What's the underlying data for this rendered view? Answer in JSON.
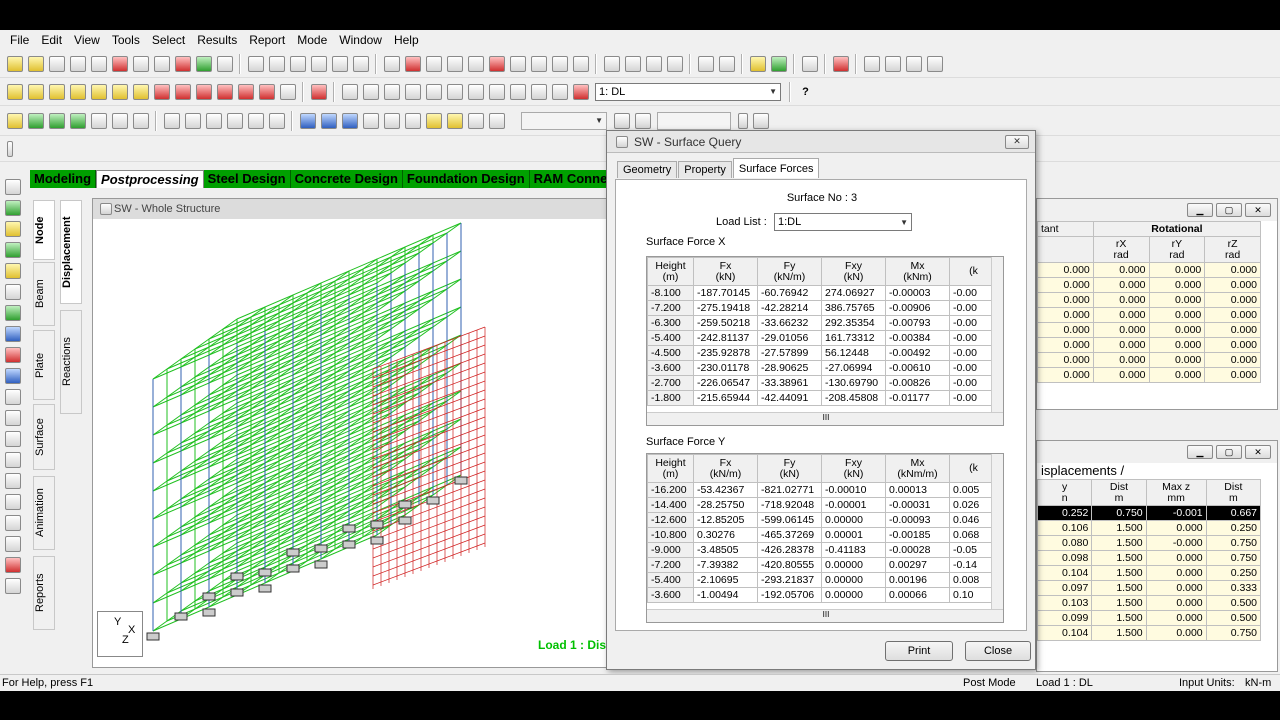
{
  "menu": [
    "File",
    "Edit",
    "View",
    "Tools",
    "Select",
    "Results",
    "Report",
    "Mode",
    "Window",
    "Help"
  ],
  "toolbar": {
    "load_combo": "1: DL"
  },
  "page_tabs": [
    "Modeling",
    "Postprocessing",
    "Steel Design",
    "Concrete Design",
    "Foundation Design",
    "RAM Connect"
  ],
  "left_vtabs": [
    "Node",
    "Beam",
    "Plate",
    "Surface",
    "Animation",
    "Reports"
  ],
  "left_vtabs2": [
    "Displacement",
    "Reactions"
  ],
  "structure_window": {
    "title": "SW - Whole Structure",
    "load_label": "Load 1 : Dis",
    "axis_y": "Y",
    "axis_x": "X",
    "axis_z": "Z"
  },
  "dialog": {
    "title": "SW - Surface Query",
    "tabs": [
      "Geometry",
      "Property",
      "Surface Forces"
    ],
    "surface_no": "Surface No : 3",
    "load_list_label": "Load List :",
    "load_list_value": "1:DL",
    "forcex_label": "Surface Force X",
    "forcey_label": "Surface Force Y",
    "print_btn": "Print",
    "close_btn": "Close",
    "tableX": {
      "headers": [
        [
          "Height",
          "(m)"
        ],
        [
          "Fx",
          "(kN)"
        ],
        [
          "Fy",
          "(kN/m)"
        ],
        [
          "Fxy",
          "(kN)"
        ],
        [
          "Mx",
          "(kNm)"
        ],
        [
          "(k",
          ""
        ]
      ],
      "rows": [
        [
          "-8.100",
          "-187.70145",
          "-60.76942",
          "274.06927",
          "-0.00003",
          "-0.00"
        ],
        [
          "-7.200",
          "-275.19418",
          "-42.28214",
          "386.75765",
          "-0.00906",
          "-0.00"
        ],
        [
          "-6.300",
          "-259.50218",
          "-33.66232",
          "292.35354",
          "-0.00793",
          "-0.00"
        ],
        [
          "-5.400",
          "-242.81137",
          "-29.01056",
          "161.73312",
          "-0.00384",
          "-0.00"
        ],
        [
          "-4.500",
          "-235.92878",
          "-27.57899",
          "56.12448",
          "-0.00492",
          "-0.00"
        ],
        [
          "-3.600",
          "-230.01178",
          "-28.90625",
          "-27.06994",
          "-0.00610",
          "-0.00"
        ],
        [
          "-2.700",
          "-226.06547",
          "-33.38961",
          "-130.69790",
          "-0.00826",
          "-0.00"
        ],
        [
          "-1.800",
          "-215.65944",
          "-42.44091",
          "-208.45808",
          "-0.01177",
          "-0.00"
        ]
      ]
    },
    "tableY": {
      "headers": [
        [
          "Height",
          "(m)"
        ],
        [
          "Fx",
          "(kN/m)"
        ],
        [
          "Fy",
          "(kN)"
        ],
        [
          "Fxy",
          "(kN)"
        ],
        [
          "Mx",
          "(kNm/m)"
        ],
        [
          "(k",
          ""
        ]
      ],
      "rows": [
        [
          "-16.200",
          "-53.42367",
          "-821.02771",
          "-0.00010",
          "0.00013",
          "0.005"
        ],
        [
          "-14.400",
          "-28.25750",
          "-718.92048",
          "-0.00001",
          "-0.00031",
          "0.026"
        ],
        [
          "-12.600",
          "-12.85205",
          "-599.06145",
          "0.00000",
          "-0.00093",
          "0.046"
        ],
        [
          "-10.800",
          "0.30276",
          "-465.37269",
          "0.00001",
          "-0.00185",
          "0.068"
        ],
        [
          "-9.000",
          "-3.48505",
          "-426.28378",
          "-0.41183",
          "-0.00028",
          "-0.05"
        ],
        [
          "-7.200",
          "-7.39382",
          "-420.80555",
          "0.00000",
          "0.00297",
          "-0.14"
        ],
        [
          "-5.400",
          "-2.10695",
          "-293.21837",
          "0.00000",
          "0.00196",
          "0.008"
        ],
        [
          "-3.600",
          "-1.00494",
          "-192.05706",
          "0.00000",
          "0.00066",
          "0.10"
        ]
      ]
    }
  },
  "right_top": {
    "group_headers": [
      "tant",
      "Rotational"
    ],
    "col_headers": [
      [
        "",
        ""
      ],
      [
        "rX",
        "rad"
      ],
      [
        "rY",
        "rad"
      ],
      [
        "rZ",
        "rad"
      ]
    ],
    "rows": [
      [
        "0.000",
        "0.000",
        "0.000",
        "0.000"
      ],
      [
        "0.000",
        "0.000",
        "0.000",
        "0.000"
      ],
      [
        "0.000",
        "0.000",
        "0.000",
        "0.000"
      ],
      [
        "0.000",
        "0.000",
        "0.000",
        "0.000"
      ],
      [
        "0.000",
        "0.000",
        "0.000",
        "0.000"
      ],
      [
        "0.000",
        "0.000",
        "0.000",
        "0.000"
      ],
      [
        "0.000",
        "0.000",
        "0.000",
        "0.000"
      ],
      [
        "0.000",
        "0.000",
        "0.000",
        "0.000"
      ]
    ]
  },
  "right_bottom": {
    "tab": "isplacements",
    "col_headers": [
      [
        "y",
        "n"
      ],
      [
        "Dist",
        "m"
      ],
      [
        "Max z",
        "mm"
      ],
      [
        "Dist",
        "m"
      ]
    ],
    "rows": [
      [
        "0.252",
        "0.750",
        "-0.001",
        "0.667"
      ],
      [
        "0.106",
        "1.500",
        "0.000",
        "0.250"
      ],
      [
        "0.080",
        "1.500",
        "-0.000",
        "0.750"
      ],
      [
        "0.098",
        "1.500",
        "0.000",
        "0.750"
      ],
      [
        "0.104",
        "1.500",
        "0.000",
        "0.250"
      ],
      [
        "0.097",
        "1.500",
        "0.000",
        "0.333"
      ],
      [
        "0.103",
        "1.500",
        "0.000",
        "0.500"
      ],
      [
        "0.099",
        "1.500",
        "0.000",
        "0.500"
      ],
      [
        "0.104",
        "1.500",
        "0.000",
        "0.750"
      ]
    ]
  },
  "status": {
    "help": "For Help, press F1",
    "mode": "Post Mode",
    "load": "Load 1 : DL",
    "units_label": "Input Units:",
    "units": "kN-m"
  }
}
